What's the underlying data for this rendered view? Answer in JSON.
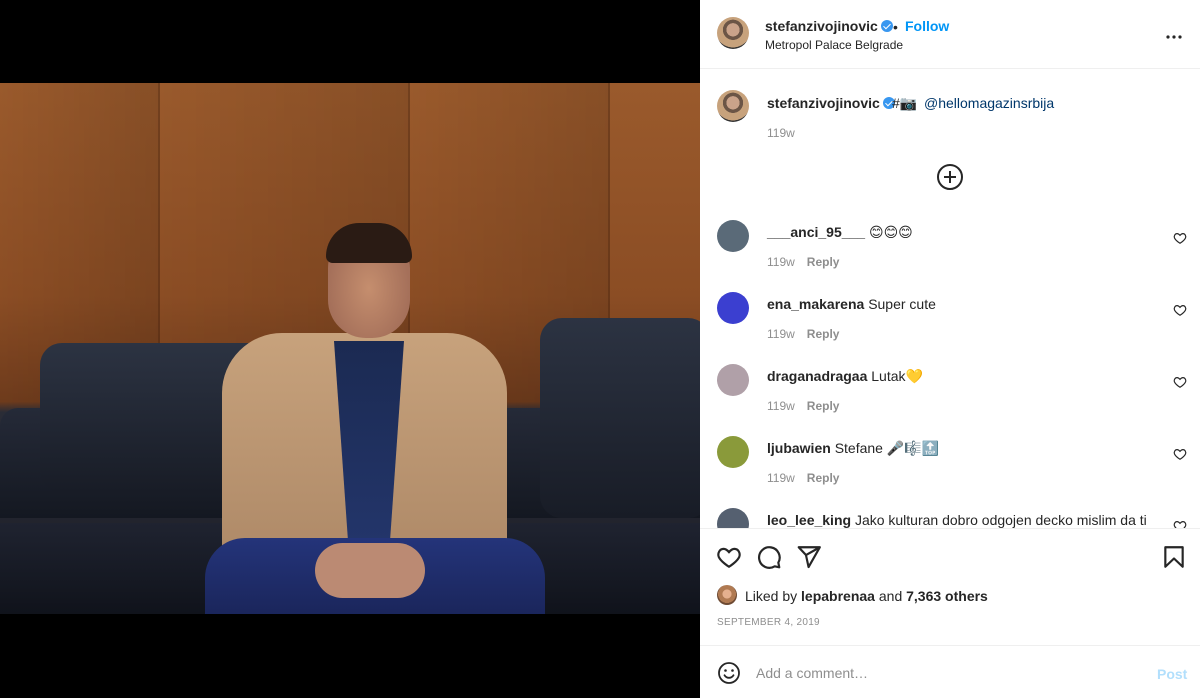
{
  "header": {
    "username": "stefanzivojinovic",
    "separator": "•",
    "follow_label": "Follow",
    "location": "Metropol Palace Belgrade",
    "more_icon": "more-options-icon"
  },
  "caption": {
    "username": "stefanzivojinovic",
    "emoji": "#📷",
    "mention": "@hellomagazinsrbija",
    "time": "119w"
  },
  "comments": [
    {
      "username": "___anci_95___",
      "text": "😊😊😊",
      "time": "119w",
      "reply": "Reply",
      "avatar_color": "#5a6a78"
    },
    {
      "username": "ena_makarena",
      "text": "Super cute",
      "time": "119w",
      "reply": "Reply",
      "avatar_color": "#3b3fd0"
    },
    {
      "username": "draganadragaa",
      "text": "Lutak💛",
      "time": "119w",
      "reply": "Reply",
      "avatar_color": "#b0a0a8"
    },
    {
      "username": "ljubawien",
      "text": "Stefane 🎤🎼🔝",
      "time": "119w",
      "reply": "Reply",
      "avatar_color": "#8a9a3a"
    },
    {
      "username": "leo_lee_king",
      "text": "Jako kulturan dobro odgojen decko mislim da ti",
      "time": "",
      "reply": "",
      "avatar_color": "#556070"
    }
  ],
  "likes": {
    "prefix": "Liked by",
    "user": "lepabrenaa",
    "connector": "and",
    "others": "7,363 others"
  },
  "date": "SEPTEMBER 4, 2019",
  "comment_input": {
    "placeholder": "Add a comment…",
    "post_label": "Post"
  },
  "colors": {
    "accent": "#0095f6",
    "post_disabled": "#b2dffc",
    "verified": "#3897f0",
    "muted": "#8e8e8e"
  }
}
